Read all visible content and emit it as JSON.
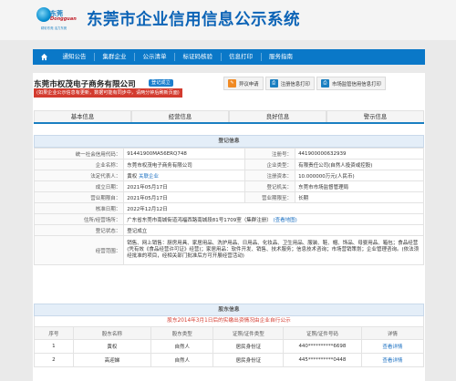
{
  "header": {
    "logo_name": "东莞",
    "logo_name_en": "Dongguan",
    "logo_slogan": "精彩东莞  活力东莞",
    "site_title": "东莞市企业信用信息公示系统"
  },
  "nav": {
    "items": [
      "通知公告",
      "集群企业",
      "公示清单",
      "标证码核验",
      "信息打印",
      "服务指南"
    ]
  },
  "company": {
    "name": "东莞市权茂电子商务有限公司",
    "status_badge": "登记成立",
    "actions": [
      {
        "label": "异议申请",
        "icon": "edit-icon",
        "color": "#f08a24"
      },
      {
        "label": "注册信息打印",
        "icon": "print-icon",
        "color": "#1a7fc1"
      },
      {
        "label": "市场监管信用信息打印",
        "icon": "print-icon",
        "color": "#1a7fc1"
      }
    ],
    "hint": "(如果企业公示信息有更新，数据可能有同步中，请两分钟后刷新页面)"
  },
  "tabs": [
    "基本信息",
    "经营信息",
    "良好信息",
    "警示信息"
  ],
  "registration": {
    "title": "登记信息",
    "credit_code_label": "统一社会信用代码：",
    "credit_code": "91441900MA56ERQ748",
    "reg_no_label": "注册号：",
    "reg_no": "441900000632939",
    "name_label": "企业名称：",
    "name": "东莞市权茂电子商务有限公司",
    "type_label": "企业类型：",
    "type": "有限责任公司(自然人投资或控股)",
    "rep_label": "法定代表人：",
    "rep": "黄权",
    "rep_link": "关联企业",
    "capital_label": "注册资本：",
    "capital": "10.000000万元(人民币)",
    "est_date_label": "成立日期：",
    "est_date": "2021年05月17日",
    "authority_label": "登记机关：",
    "authority": "东莞市市场监督管理局",
    "op_from_label": "营业期限自：",
    "op_from": "2021年05月17日",
    "op_to_label": "营业期限至：",
    "op_to": "长期",
    "approve_date_label": "核准日期：",
    "approve_date": "2022年12月12日",
    "address_label": "住所/经营场所：",
    "address": "广东省东莞市南城街道鸿福西路南城段81号1709室（集群注册）",
    "address_link": "(查看地图)",
    "status_label": "登记状态：",
    "status": "登记成立",
    "scope_label": "经营范围：",
    "scope": "销售、网上销售：厨房用具、家居用品、洗护用品、日用品、化妆品、卫生用品、服装、鞋、帽、饰品、母婴用品、箱包；食品经营(凭有效《食品经营许可证》经营)；家居用品：软件开发、销售、技术服务；信息技术咨询；市场营销策划；企业管理咨询。(依法须经批准的项目，经相关部门批准后方可开展经营活动)"
  },
  "shareholders": {
    "title": "股东信息",
    "notice": "股东2014年3月1日后的实缴出资情况由企业自行公示",
    "columns": [
      "序号",
      "股东名称",
      "股东类型",
      "证照/证件类型",
      "证照/证件号码",
      "详情"
    ],
    "rows": [
      {
        "no": "1",
        "name": "黄权",
        "type": "自然人",
        "id_type": "居民身份证",
        "id_no": "440**********6698",
        "detail": "查看详情"
      },
      {
        "no": "2",
        "name": "高迎娣",
        "type": "自然人",
        "id_type": "居民身份证",
        "id_no": "445**********0448",
        "detail": "查看详情"
      }
    ]
  }
}
